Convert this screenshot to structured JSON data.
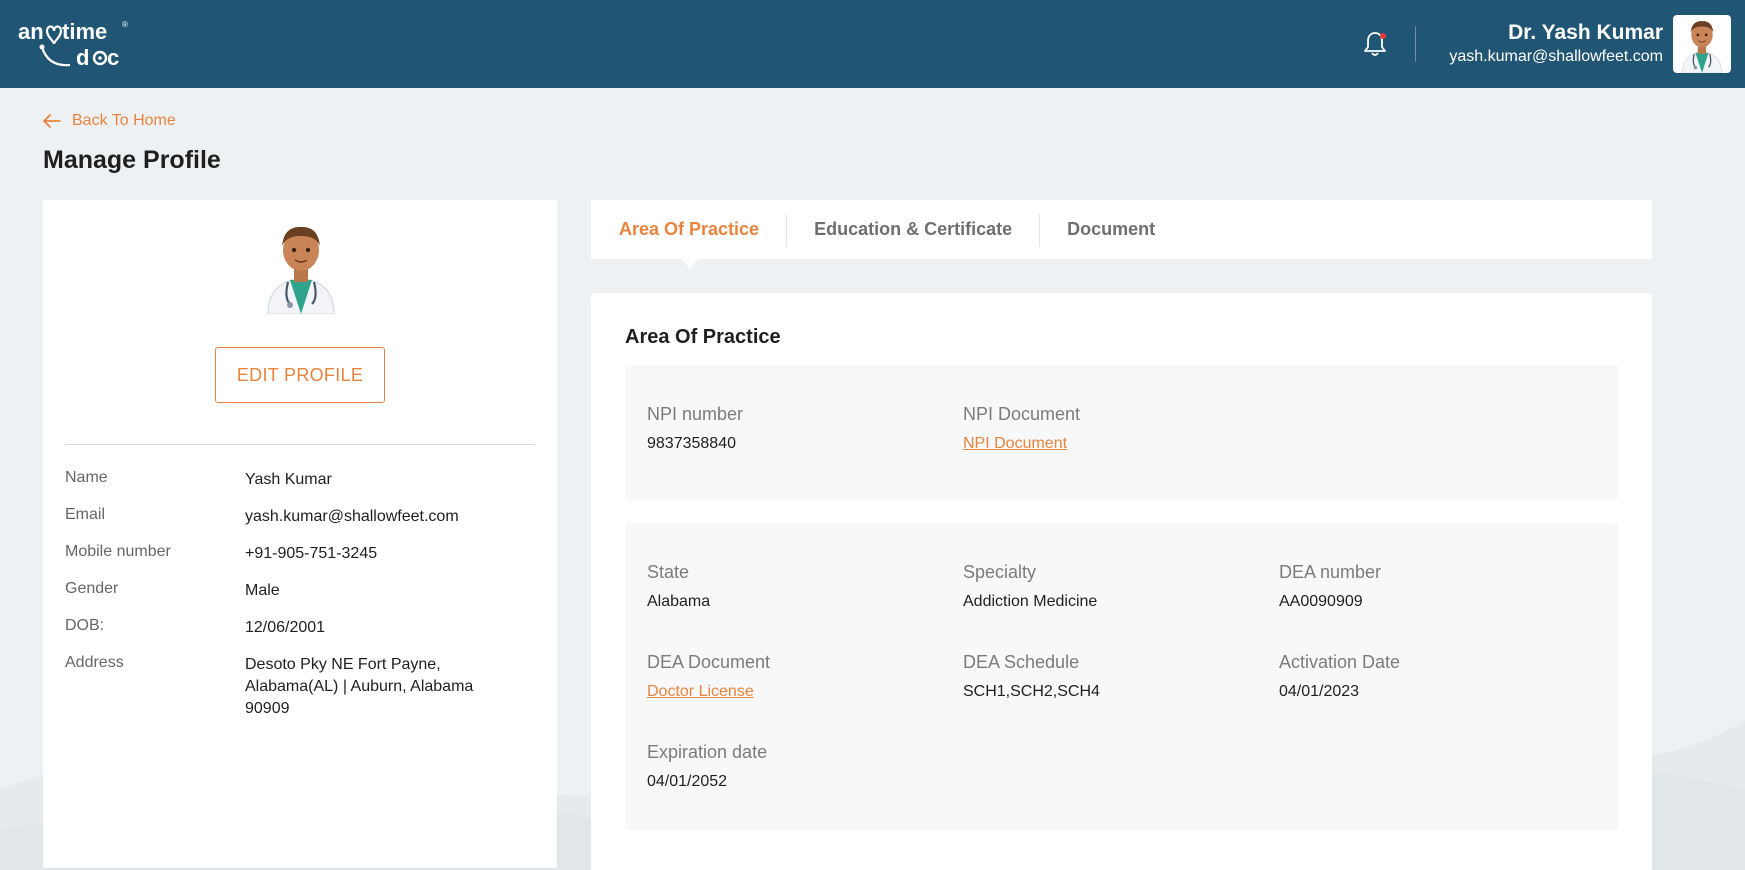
{
  "colors": {
    "header_bg": "#215574",
    "accent": "#e8843e",
    "page_bg": "#eef1f4"
  },
  "header": {
    "logo_text_top": "an time",
    "logo_text_bottom": "d c",
    "notification_icon": "bell-icon",
    "user_name": "Dr. Yash Kumar",
    "user_email": "yash.kumar@shallowfeet.com"
  },
  "page": {
    "back_label": "Back To Home",
    "title": "Manage Profile"
  },
  "profile": {
    "edit_label": "EDIT PROFILE",
    "fields": [
      {
        "label": "Name",
        "value": "Yash Kumar"
      },
      {
        "label": "Email",
        "value": "yash.kumar@shallowfeet.com"
      },
      {
        "label": "Mobile number",
        "value": "+91-905-751-3245"
      },
      {
        "label": "Gender",
        "value": "Male"
      },
      {
        "label": "DOB:",
        "value": "12/06/2001"
      },
      {
        "label": "Address",
        "value": "Desoto Pky NE Fort Payne, Alabama(AL) | Auburn, Alabama 90909"
      }
    ]
  },
  "tabs": [
    {
      "label": "Area Of Practice",
      "active": true
    },
    {
      "label": "Education & Certificate",
      "active": false
    },
    {
      "label": "Document",
      "active": false
    }
  ],
  "practice": {
    "section_title": "Area Of Practice",
    "npi_number_label": "NPI number",
    "npi_number_value": "9837358840",
    "npi_document_label": "NPI Document",
    "npi_document_link": "NPI Document",
    "state_label": "State",
    "state_value": "Alabama",
    "specialty_label": "Specialty",
    "specialty_value": "Addiction Medicine",
    "dea_number_label": "DEA number",
    "dea_number_value": "AA0090909",
    "dea_document_label": "DEA Document",
    "dea_document_link": "Doctor License",
    "dea_schedule_label": "DEA Schedule",
    "dea_schedule_value": "SCH1,SCH2,SCH4",
    "activation_label": "Activation Date",
    "activation_value": "04/01/2023",
    "expiration_label": "Expiration date",
    "expiration_value": "04/01/2052"
  }
}
